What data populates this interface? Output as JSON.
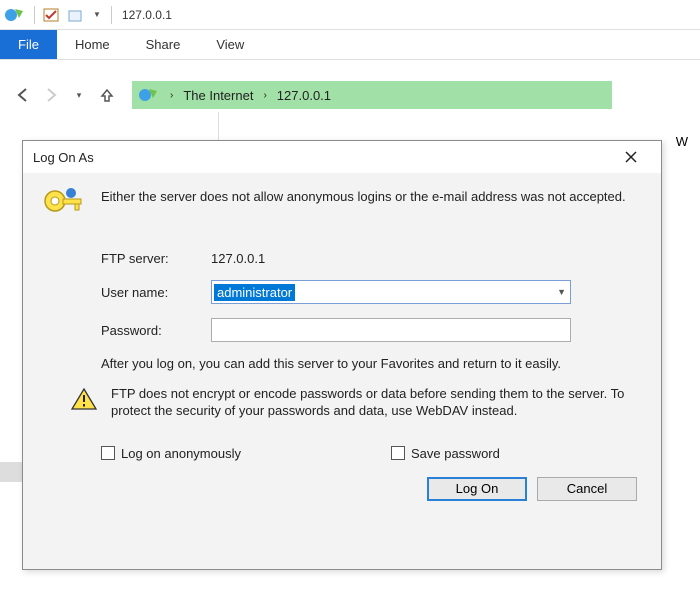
{
  "titlebar": {
    "title": "127.0.0.1"
  },
  "ribbon": {
    "file": "File",
    "home": "Home",
    "share": "Share",
    "view": "View"
  },
  "breadcrumb": {
    "root": "The Internet",
    "current": "127.0.0.1"
  },
  "sidebar_hint": "W",
  "dialog": {
    "title": "Log On As",
    "message": "Either the server does not allow anonymous logins or the e-mail address was not accepted.",
    "ftp_server_label": "FTP server:",
    "ftp_server_value": "127.0.0.1",
    "username_label": "User name:",
    "username_value": "administrator",
    "password_label": "Password:",
    "password_value": "",
    "hint": "After you log on, you can add this server to your Favorites and return to it easily.",
    "warning": "FTP does not encrypt or encode passwords or data before sending them to the server.  To protect the security of your passwords and data, use WebDAV instead.",
    "anon_label": "Log on anonymously",
    "save_label": "Save password",
    "logon_btn": "Log On",
    "cancel_btn": "Cancel"
  }
}
